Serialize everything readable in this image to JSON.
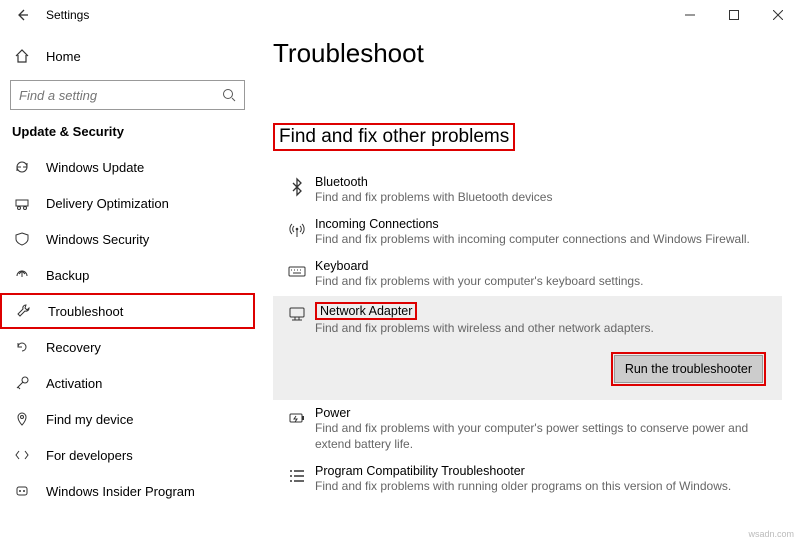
{
  "titlebar": {
    "title": "Settings"
  },
  "sidebar": {
    "home": "Home",
    "search_placeholder": "Find a setting",
    "category": "Update & Security",
    "items": [
      {
        "label": "Windows Update"
      },
      {
        "label": "Delivery Optimization"
      },
      {
        "label": "Windows Security"
      },
      {
        "label": "Backup"
      },
      {
        "label": "Troubleshoot"
      },
      {
        "label": "Recovery"
      },
      {
        "label": "Activation"
      },
      {
        "label": "Find my device"
      },
      {
        "label": "For developers"
      },
      {
        "label": "Windows Insider Program"
      }
    ]
  },
  "main": {
    "title": "Troubleshoot",
    "section_header": "Find and fix other problems",
    "items": [
      {
        "name": "Bluetooth",
        "desc": "Find and fix problems with Bluetooth devices"
      },
      {
        "name": "Incoming Connections",
        "desc": "Find and fix problems with incoming computer connections and Windows Firewall."
      },
      {
        "name": "Keyboard",
        "desc": "Find and fix problems with your computer's keyboard settings."
      },
      {
        "name": "Network Adapter",
        "desc": "Find and fix problems with wireless and other network adapters."
      },
      {
        "name": "Power",
        "desc": "Find and fix problems with your computer's power settings to conserve power and extend battery life."
      },
      {
        "name": "Program Compatibility Troubleshooter",
        "desc": "Find and fix problems with running older programs on this version of Windows."
      }
    ],
    "run_button": "Run the troubleshooter"
  },
  "watermark": "wsadn.com"
}
